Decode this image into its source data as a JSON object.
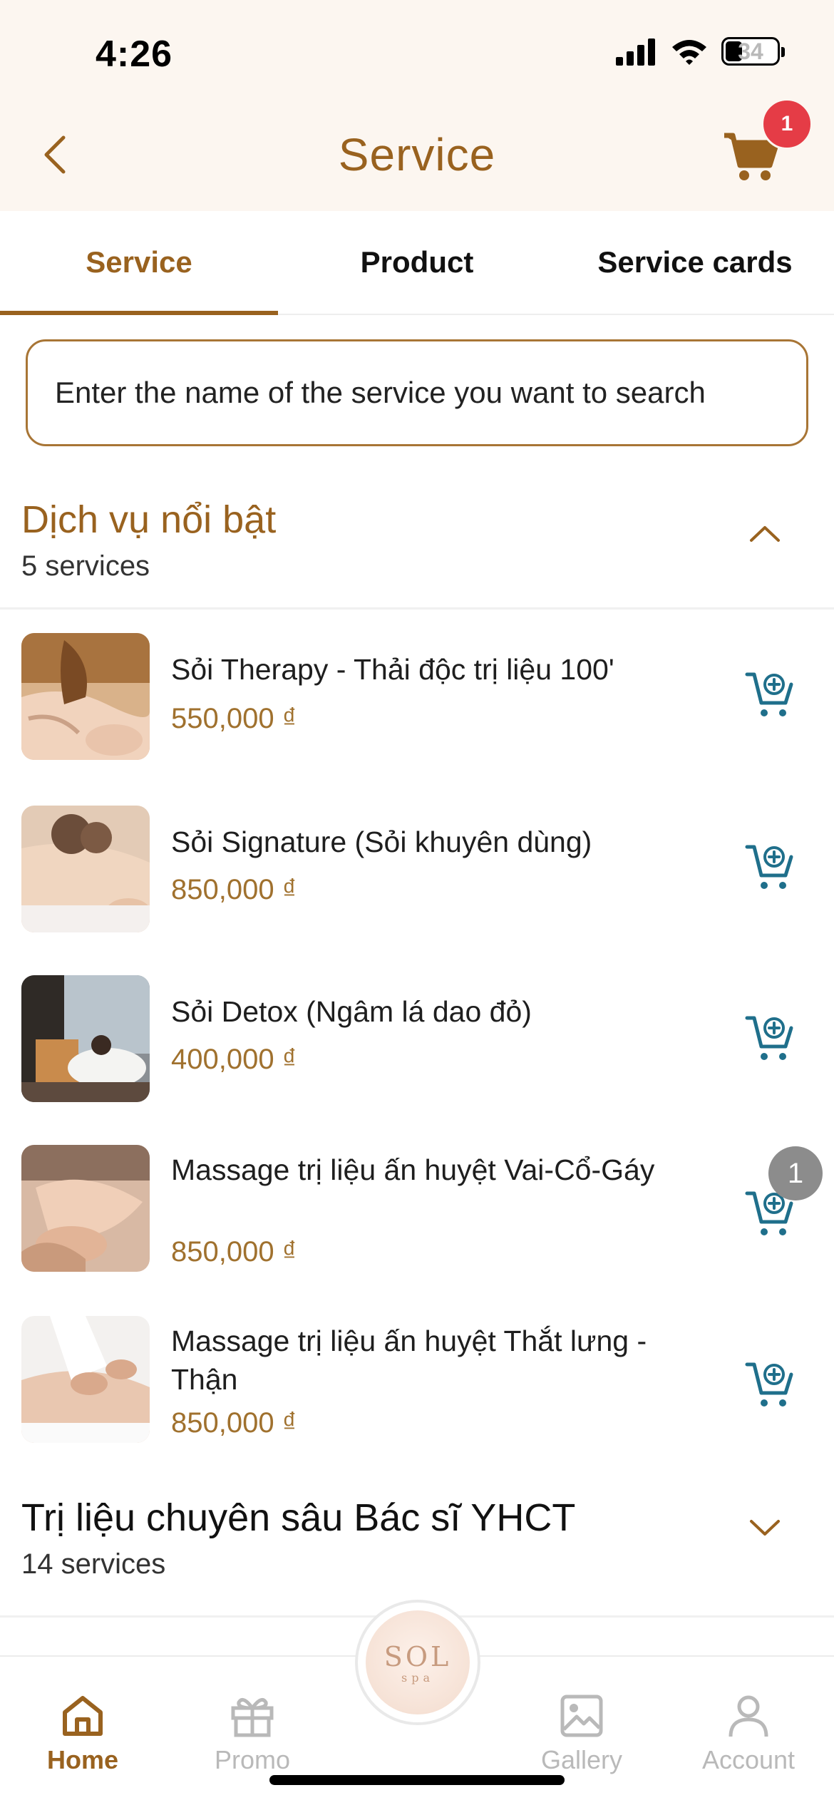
{
  "status_bar": {
    "time": "4:26",
    "battery": "34"
  },
  "header": {
    "title": "Service",
    "cart_count": "1"
  },
  "tabs": [
    {
      "label": "Service",
      "active": true
    },
    {
      "label": "Product",
      "active": false
    },
    {
      "label": "Service cards",
      "active": false
    }
  ],
  "search": {
    "placeholder": "Enter the name of the service you want to search"
  },
  "sections": [
    {
      "title": "Dịch vụ nổi bật",
      "count": "5 services",
      "expanded": true,
      "items": [
        {
          "name": "Sỏi Therapy - Thải độc trị liệu 100'",
          "price": "550,000 ₫"
        },
        {
          "name": "Sỏi Signature (Sỏi khuyên dùng)",
          "price": "850,000 ₫"
        },
        {
          "name": "Sỏi Detox (Ngâm lá dao đỏ)",
          "price": "400,000 ₫"
        },
        {
          "name": "Massage trị liệu ấn huyệt Vai-Cổ-Gáy",
          "price": "850,000 ₫"
        },
        {
          "name": "Massage trị liệu ấn huyệt Thắt lưng - Thận",
          "price": "850,000 ₫"
        }
      ]
    },
    {
      "title": "Trị liệu chuyên sâu Bác sĩ YHCT",
      "count": "14 services",
      "expanded": false
    }
  ],
  "floating_badge": "1",
  "bottom_nav": [
    {
      "label": "Home",
      "icon": "home-icon",
      "active": true
    },
    {
      "label": "Promo",
      "icon": "gift-icon",
      "active": false
    },
    {
      "label": "Gallery",
      "icon": "image-icon",
      "active": false
    },
    {
      "label": "Account",
      "icon": "user-icon",
      "active": false
    }
  ],
  "logo": {
    "main": "SOL",
    "sub": "spa"
  },
  "colors": {
    "brand": "#99621f",
    "price": "#a0712e",
    "badge": "#e53c46",
    "cart_icon": "#1f6f8b",
    "header_bg": "#fcf6f0"
  }
}
